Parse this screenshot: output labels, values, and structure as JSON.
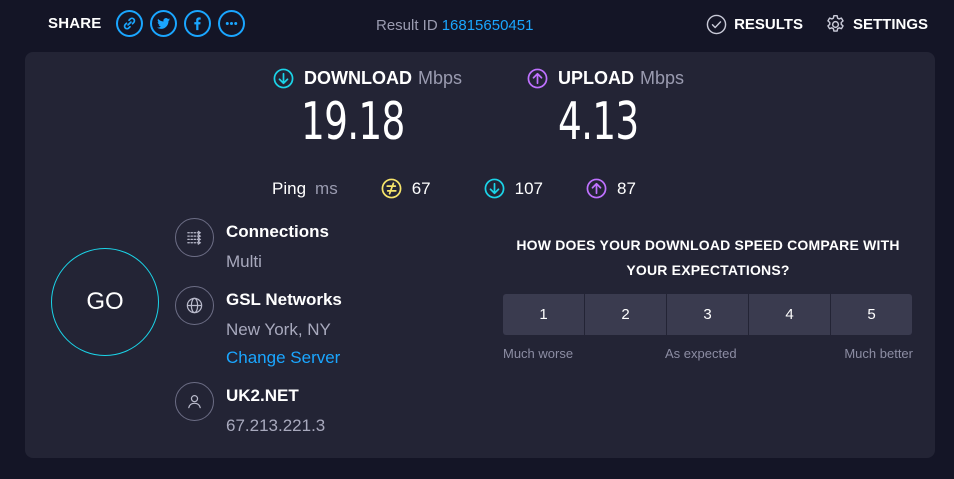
{
  "topbar": {
    "share_label": "SHARE",
    "share_buttons": [
      "link-icon",
      "twitter-icon",
      "facebook-icon",
      "more-icon"
    ],
    "result_id_label": "Result ID",
    "result_id_value": "16815650451",
    "results_label": "RESULTS",
    "settings_label": "SETTINGS"
  },
  "colors": {
    "background": "#141526",
    "panel": "#232435",
    "accent_blue": "#1aa6ff",
    "download_cyan": "#1bd4e8",
    "upload_purple": "#bf71ff",
    "jitter_yellow": "#f7e56b"
  },
  "speed": {
    "download": {
      "label": "DOWNLOAD",
      "unit": "Mbps",
      "value": "19.18",
      "icon": "download-arrow-icon"
    },
    "upload": {
      "label": "UPLOAD",
      "unit": "Mbps",
      "value": "4.13",
      "icon": "upload-arrow-icon"
    }
  },
  "ping": {
    "label": "Ping",
    "unit": "ms",
    "idle": "67",
    "download": "107",
    "upload": "87"
  },
  "go_label": "GO",
  "server": {
    "connections_title": "Connections",
    "connections_value": "Multi",
    "host_name": "GSL Networks",
    "host_location": "New York, NY",
    "change_server_label": "Change Server",
    "isp_name": "UK2.NET",
    "isp_ip": "67.213.221.3"
  },
  "survey": {
    "question": "HOW DOES YOUR DOWNLOAD SPEED COMPARE WITH YOUR EXPECTATIONS?",
    "options": [
      "1",
      "2",
      "3",
      "4",
      "5"
    ],
    "low_label": "Much worse",
    "mid_label": "As expected",
    "high_label": "Much better"
  }
}
